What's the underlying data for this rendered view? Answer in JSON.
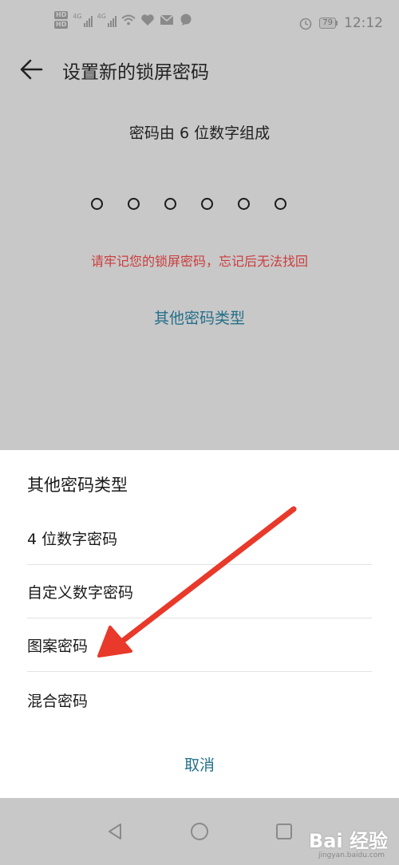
{
  "status_bar": {
    "hd_badges": [
      "HD",
      "HD"
    ],
    "signal_labels": [
      "4G",
      "4G"
    ],
    "icons": [
      "wifi-icon",
      "heart-icon",
      "mail-icon",
      "chat-icon",
      "alarm-icon"
    ],
    "battery": "79",
    "time": "12:12"
  },
  "header": {
    "back_icon": "back-arrow-icon",
    "title": "设置新的锁屏密码"
  },
  "main": {
    "subtitle": "密码由 6 位数字组成",
    "pin_length": 6,
    "warning": "请牢记您的锁屏密码，忘记后无法找回",
    "other_types_link": "其他密码类型"
  },
  "sheet": {
    "title": "其他密码类型",
    "options": [
      {
        "label": "4 位数字密码"
      },
      {
        "label": "自定义数字密码"
      },
      {
        "label": "图案密码"
      },
      {
        "label": "混合密码"
      }
    ],
    "cancel": "取消"
  },
  "nav_bar": {
    "icons": [
      "back-triangle-icon",
      "home-circle-icon",
      "recents-square-icon"
    ]
  },
  "watermark": {
    "brand": "Bai 经验",
    "url": "jingyan.baidu.com"
  },
  "colors": {
    "accent": "#24708a",
    "warning": "#cc3c3c",
    "annotation_arrow": "#e8392a",
    "overlay": "#c8c8c8"
  }
}
